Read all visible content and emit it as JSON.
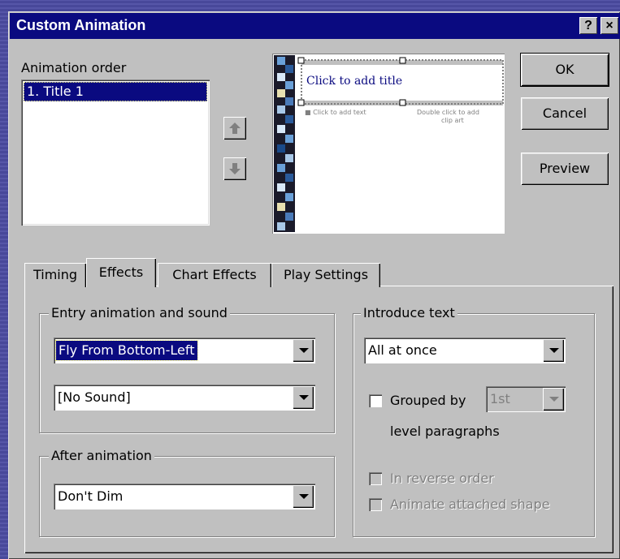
{
  "window": {
    "title": "Custom Animation",
    "help_label": "?",
    "close_label": "×"
  },
  "order": {
    "label": "Animation order",
    "items": [
      "1. Title 1"
    ]
  },
  "preview_slide": {
    "title_placeholder": "Click to add title",
    "text_placeholder": "■ Click to add text",
    "clipart_placeholder_1": "Double click to add",
    "clipart_placeholder_2": "clip art"
  },
  "buttons": {
    "ok": "OK",
    "cancel": "Cancel",
    "preview": "Preview"
  },
  "tabs": [
    "Timing",
    "Effects",
    "Chart Effects",
    "Play Settings"
  ],
  "entry": {
    "group_label": "Entry animation and sound",
    "effect_value": "Fly From Bottom-Left",
    "sound_value": "[No Sound]"
  },
  "after": {
    "group_label": "After animation",
    "value": "Don't Dim"
  },
  "introduce": {
    "group_label": "Introduce text",
    "value": "All at once",
    "grouped_by_label": "Grouped by",
    "grouped_level_value": "1st",
    "level_paragraphs_label": "level paragraphs",
    "reverse_label": "In reverse order",
    "attached_label": "Animate attached shape"
  }
}
